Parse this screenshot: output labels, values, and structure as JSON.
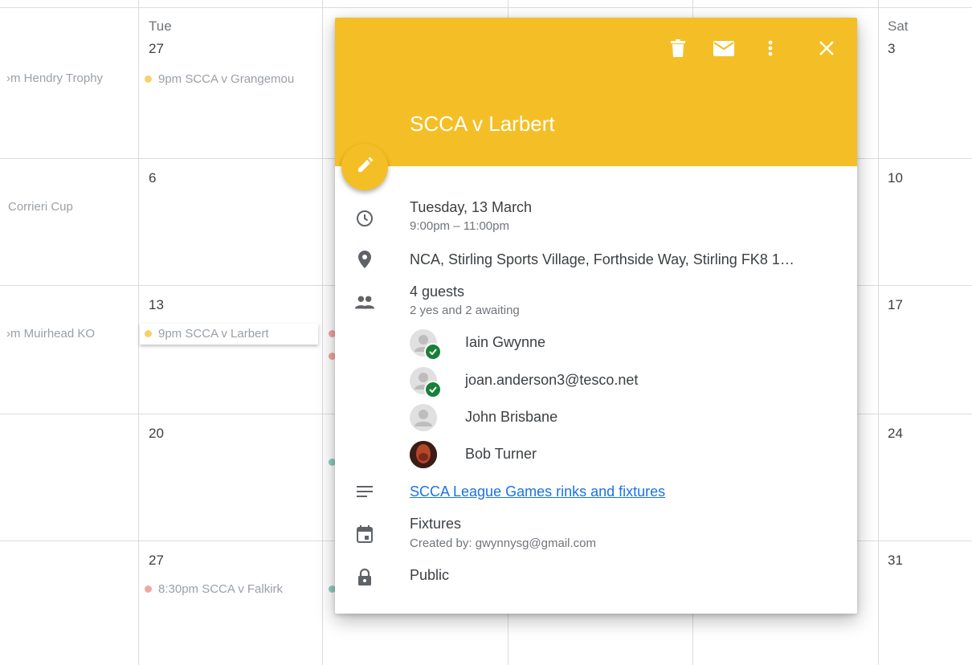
{
  "calendar": {
    "header": [
      {
        "day": "Tue",
        "date": "27"
      },
      {
        "day": "Sat",
        "date": "3"
      }
    ],
    "week1": {
      "left_event": "›m Hendry Trophy",
      "tue_event": "9pm SCCA v Grangemou"
    },
    "week2": {
      "left_event": "Corrieri Cup",
      "tue_date": "6",
      "sat_date": "10"
    },
    "week3": {
      "left_event": "›m Muirhead KO",
      "tue_date": "13",
      "tue_event": "9pm SCCA v Larbert",
      "sat_date": "17"
    },
    "week4": {
      "tue_date": "20",
      "sat_date": "24"
    },
    "week5": {
      "tue_date": "27",
      "tue_event": "8:30pm SCCA v Falkirk",
      "sat_date": "31"
    },
    "colors": {
      "yellow_dot": "#f6d26b",
      "red_dot": "#f4a5a0",
      "green_dot": "#8fcbbd"
    }
  },
  "popup": {
    "header_color": "#f4bf26",
    "title": "SCCA v Larbert",
    "icons": {
      "delete": "trash-icon",
      "email": "mail-icon",
      "more": "more-vert-icon",
      "close": "close-icon",
      "edit": "pencil-icon"
    },
    "date": "Tuesday, 13 March",
    "time": "9:00pm – 11:00pm",
    "location": "NCA, Stirling Sports Village, Forthside Way, Stirling FK8 1…",
    "guests_title": "4 guests",
    "guests_summary": "2 yes and 2 awaiting",
    "guests": [
      {
        "name": "Iain Gwynne",
        "accepted": true
      },
      {
        "name": "joan.anderson3@tesco.net",
        "accepted": true
      },
      {
        "name": "John Brisbane",
        "accepted": false
      },
      {
        "name": "Bob Turner",
        "accepted": false
      }
    ],
    "description_link": "SCCA League Games rinks and fixtures",
    "calendar_name": "Fixtures",
    "created_by": "Created by: gwynnysg@gmail.com",
    "visibility": "Public"
  }
}
